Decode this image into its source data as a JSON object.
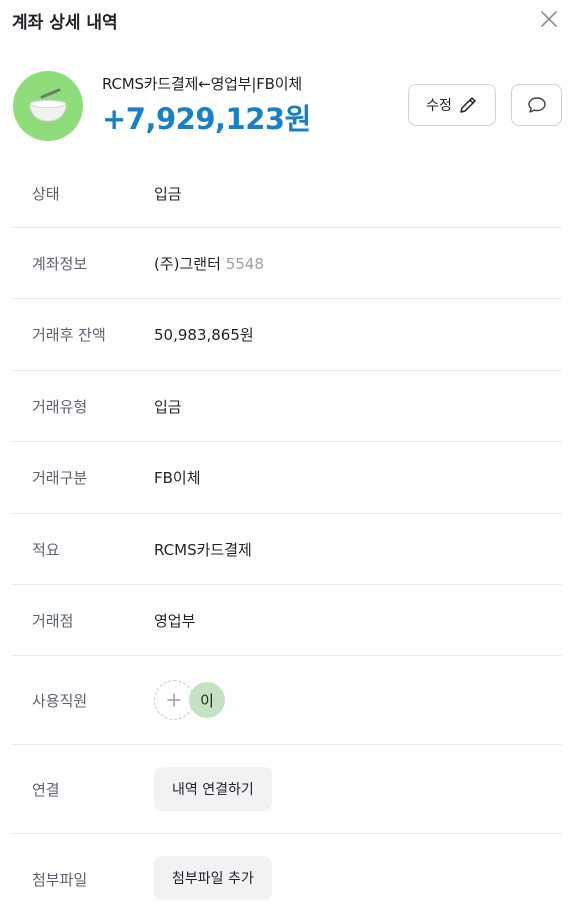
{
  "header": {
    "title": "계좌 상세 내역",
    "close_icon": "close-icon"
  },
  "summary": {
    "avatar_icon": "bowl-icon",
    "avatar_color": "#8fdc7a",
    "description": "RCMS카드결제←영업부|FB이체",
    "amount": "+7,929,123원",
    "amount_color": "#1b7fc4",
    "edit_label": "수정",
    "edit_icon": "pencil-icon",
    "memo_icon": "speech-bubble-icon"
  },
  "details": {
    "status": {
      "label": "상태",
      "value": "입금"
    },
    "account": {
      "label": "계좌정보",
      "value": "(주)그랜터",
      "suffix": "5548"
    },
    "balance": {
      "label": "거래후 잔액",
      "value": "50,983,865원"
    },
    "type": {
      "label": "거래유형",
      "value": "입금"
    },
    "category": {
      "label": "거래구분",
      "value": "FB이체"
    },
    "memo": {
      "label": "적요",
      "value": "RCMS카드결제"
    },
    "branch": {
      "label": "거래점",
      "value": "영업부"
    },
    "employee": {
      "label": "사용직원",
      "avatar_text": "이",
      "add_icon": "plus-icon"
    },
    "link": {
      "label": "연결",
      "button_label": "내역 연결하기"
    },
    "attachment": {
      "label": "첨부파일",
      "button_label": "첨부파일 추가"
    }
  }
}
